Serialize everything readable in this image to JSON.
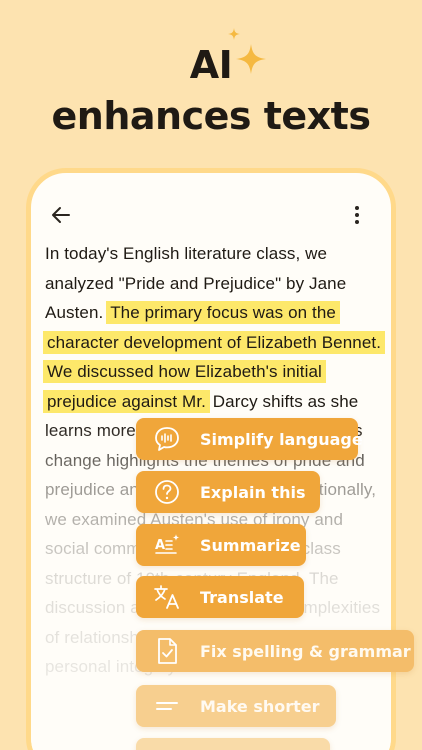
{
  "headline": {
    "line1": "AI",
    "line2": "enhances texts"
  },
  "colors": {
    "background": "#fde3b0",
    "card": "#fffdf8",
    "card_border": "#ffd98a",
    "accent": "#f0a63a",
    "highlight": "#fde86a",
    "sparkle": "#f5b941"
  },
  "toolbar": {
    "back_icon": "arrow-left-icon",
    "more_icon": "vertical-dots-icon"
  },
  "document": {
    "text_before": "In today's English literature class, we analyzed \"Pride and Prejudice\" by Jane Austen.",
    "highlighted": "The primary focus was on the character development of Elizabeth Bennet. We discussed how Elizabeth's initial prejudice against Mr.",
    "text_after": "Darcy shifts as she learns more about his true character. This change highlights the themes of pride and prejudice and personal growth. Additionally, we examined Austen's use of irony and social commentary to critique the class structure of 19th-century England. The discussion also touched on the complexities of relationships and the importance of personal integrity."
  },
  "actions": [
    {
      "label": "Simplify language",
      "icon": "speech-bubble-icon"
    },
    {
      "label": "Explain this",
      "icon": "question-circle-icon"
    },
    {
      "label": "Summarize",
      "icon": "summarize-sparkle-icon"
    },
    {
      "label": "Translate",
      "icon": "translate-icon"
    },
    {
      "label": "Fix spelling & grammar",
      "icon": "document-check-icon"
    },
    {
      "label": "Make shorter",
      "icon": "shorten-lines-icon"
    }
  ]
}
